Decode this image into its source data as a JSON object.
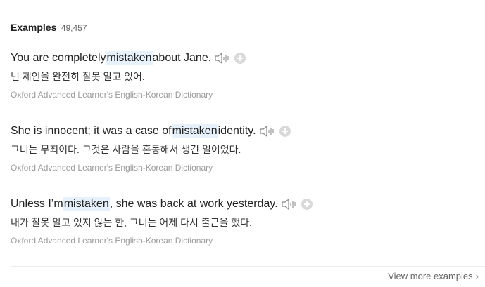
{
  "examples_header": {
    "title": "Examples",
    "count": "49,457"
  },
  "examples": [
    {
      "en_pre": "You are completely ",
      "en_hl": "mistaken",
      "en_post": " about Jane.",
      "ko": "넌 제인을 완전히 잘못 알고 있어.",
      "source": "Oxford Advanced Learner's English-Korean Dictionary"
    },
    {
      "en_pre": "She is innocent; it was a case of ",
      "en_hl": "mistaken",
      "en_post": " identity.",
      "ko": "그녀는 무죄이다. 그것은 사람을 혼동해서 생긴 일이었다.",
      "source": "Oxford Advanced Learner's English-Korean Dictionary"
    },
    {
      "en_pre": "Unless I’m ",
      "en_hl": "mistaken",
      "en_post": ", she was back at work yesterday.",
      "ko": "내가 잘못 알고 있지 않는 한, 그녀는 어제 다시 출근을 했다.",
      "source": "Oxford Advanced Learner's English-Korean Dictionary"
    }
  ],
  "icons": {
    "speaker": "speaker-icon",
    "add": "plus-circle-icon",
    "more": "chevron-right-icon"
  },
  "colors": {
    "highlight": "#e6f1fb",
    "source_text": "#9a9a9a"
  },
  "view_more": {
    "label": "View more examples"
  }
}
